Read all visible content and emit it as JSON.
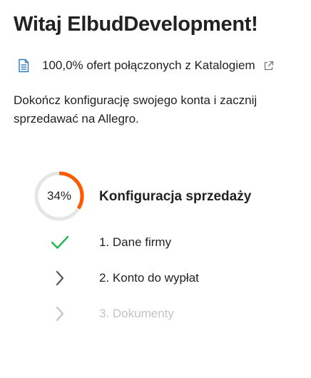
{
  "header": {
    "greeting": "Witaj ElbudDevelopment!"
  },
  "catalog": {
    "text": "100,0% ofert połączonych z Katalogiem",
    "icon": "document-icon",
    "link_icon": "external-link-icon"
  },
  "intro": {
    "text": "Dokończ konfigurację swojego konta i zacznij sprzedawać na Allegro."
  },
  "setup": {
    "title": "Konfiguracja sprzedaży",
    "progress_label": "34%",
    "progress_fraction": 0.34,
    "steps": [
      {
        "label": "1. Dane firmy",
        "status": "done",
        "icon": "check-icon"
      },
      {
        "label": "2. Konto do wypłat",
        "status": "active",
        "icon": "chevron-right-icon"
      },
      {
        "label": "3. Dokumenty",
        "status": "disabled",
        "icon": "chevron-right-icon"
      }
    ]
  },
  "colors": {
    "accent": "#ff5a00",
    "track": "#e6e6e6",
    "success": "#1fb84c",
    "text": "#222222",
    "muted": "#c4c4c4",
    "icon_blue": "#2f7bbf"
  }
}
